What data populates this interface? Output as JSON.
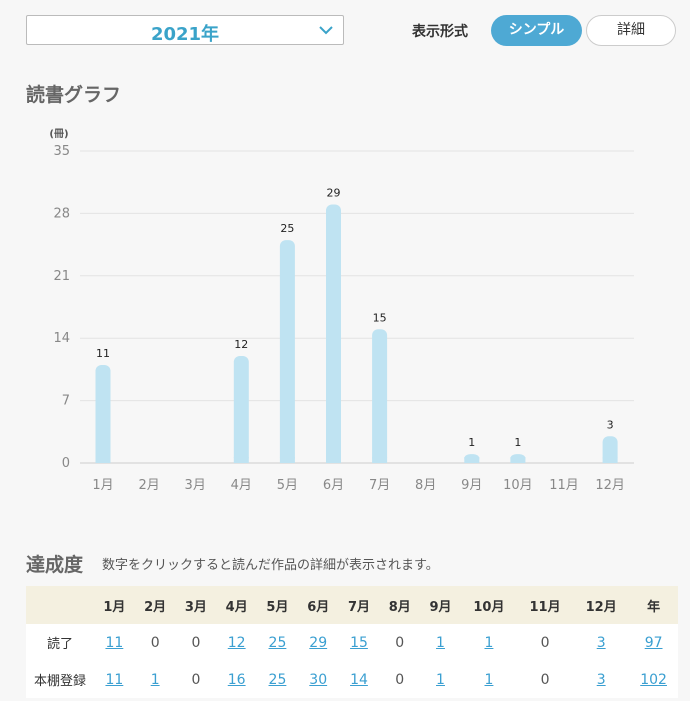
{
  "header": {
    "year_label": "2021年",
    "format_label": "表示形式",
    "simple_label": "シンプル",
    "detail_label": "詳細"
  },
  "graph_section": {
    "title": "読書グラフ"
  },
  "chart_data": {
    "type": "bar",
    "unit_label": "(冊)",
    "categories": [
      "1月",
      "2月",
      "3月",
      "4月",
      "5月",
      "6月",
      "7月",
      "8月",
      "9月",
      "10月",
      "11月",
      "12月"
    ],
    "values": [
      11,
      0,
      0,
      12,
      25,
      29,
      15,
      0,
      1,
      1,
      0,
      3
    ],
    "yticks": [
      0,
      7,
      14,
      21,
      28,
      35
    ],
    "ylim": [
      0,
      35
    ],
    "grid": true,
    "bar_color": "#bfe3f2"
  },
  "achievement": {
    "title": "達成度",
    "note": "数字をクリックすると読んだ作品の詳細が表示されます。",
    "columns": [
      "1月",
      "2月",
      "3月",
      "4月",
      "5月",
      "6月",
      "7月",
      "8月",
      "9月",
      "10月",
      "11月",
      "12月",
      "年"
    ],
    "rows": [
      {
        "label": "読了",
        "values": [
          "11",
          "0",
          "0",
          "12",
          "25",
          "29",
          "15",
          "0",
          "1",
          "1",
          "0",
          "3",
          "97"
        ]
      },
      {
        "label": "本棚登録",
        "values": [
          "11",
          "1",
          "0",
          "16",
          "25",
          "30",
          "14",
          "0",
          "1",
          "1",
          "0",
          "3",
          "102"
        ]
      }
    ]
  }
}
